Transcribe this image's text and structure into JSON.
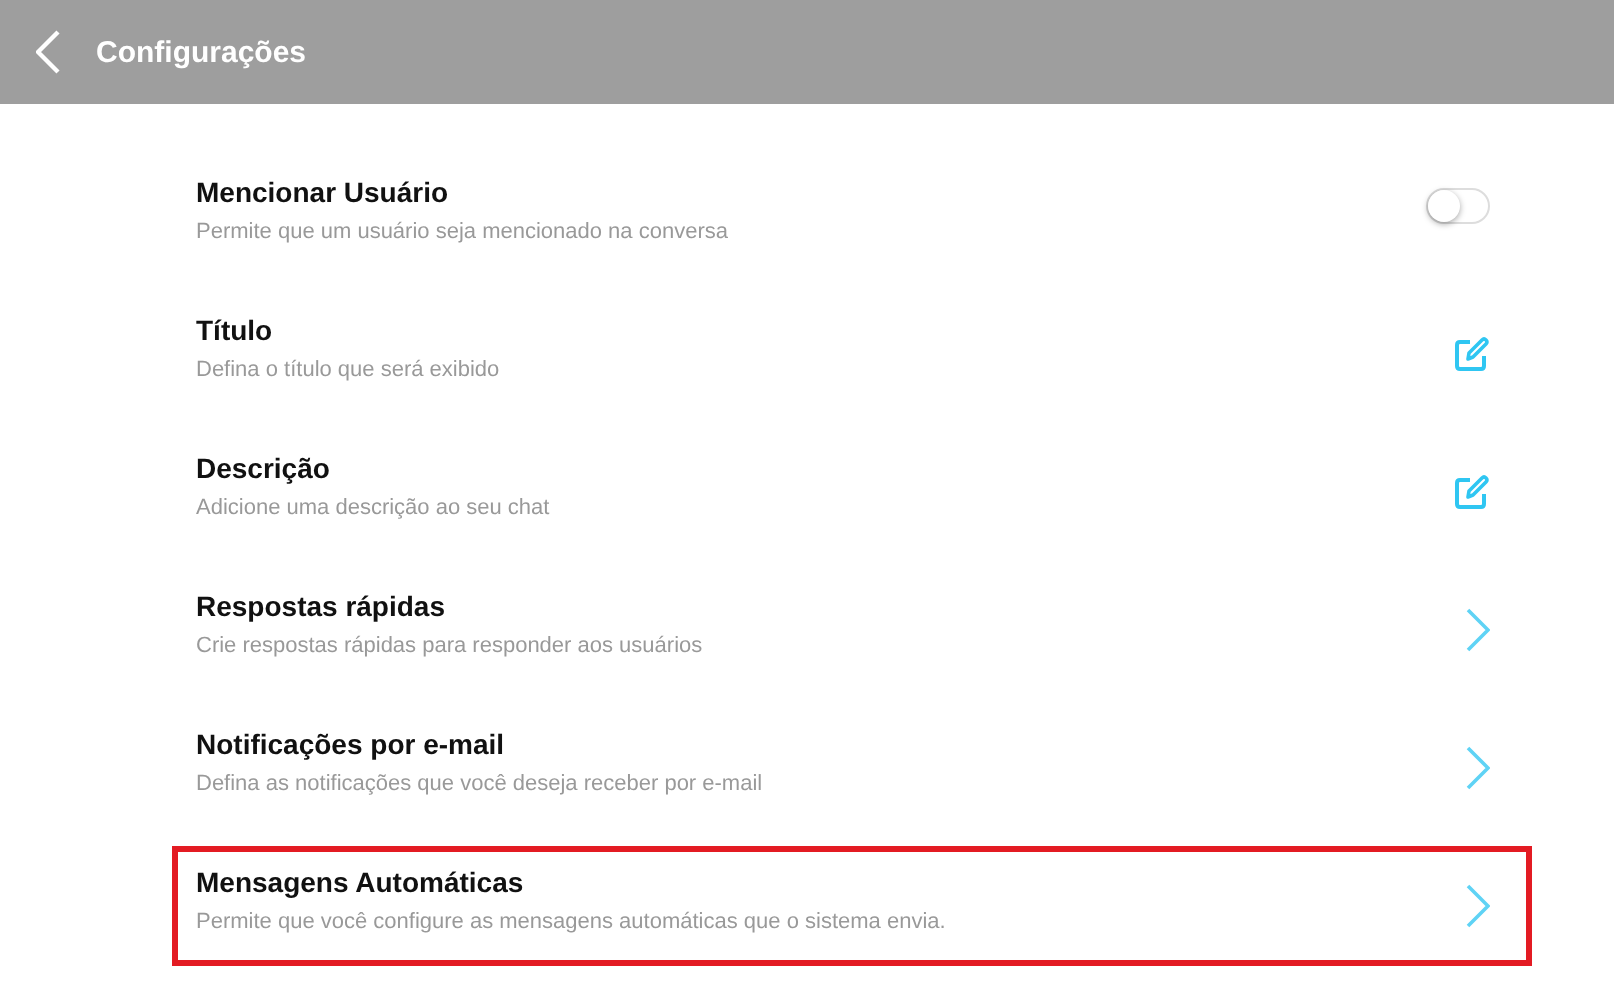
{
  "header": {
    "title": "Configurações"
  },
  "settings": [
    {
      "kind": "toggle",
      "title": "Mencionar Usuário",
      "description": "Permite que um usuário seja mencionado na conversa",
      "on": false,
      "highlighted": false
    },
    {
      "kind": "edit",
      "title": "Título",
      "description": "Defina o título que será exibido",
      "highlighted": false
    },
    {
      "kind": "edit",
      "title": "Descrição",
      "description": "Adicione uma descrição ao seu chat",
      "highlighted": false
    },
    {
      "kind": "link",
      "title": "Respostas rápidas",
      "description": "Crie respostas rápidas para responder aos usuários",
      "highlighted": false
    },
    {
      "kind": "link",
      "title": "Notificações por e-mail",
      "description": "Defina as notificações que você deseja receber por e-mail",
      "highlighted": false
    },
    {
      "kind": "link",
      "title": "Mensagens Automáticas",
      "description": "Permite que você configure as mensagens automáticas que o sistema envia.",
      "highlighted": true
    }
  ]
}
